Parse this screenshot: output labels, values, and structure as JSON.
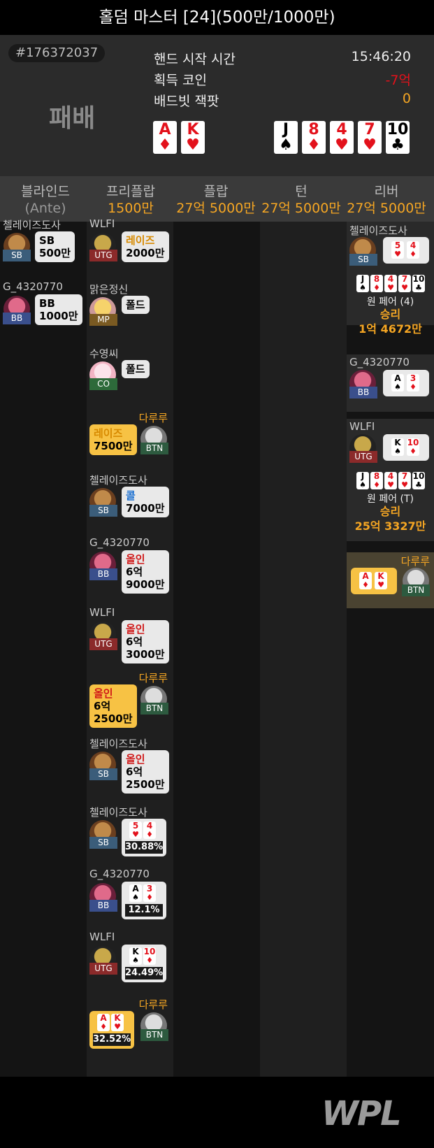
{
  "header": {
    "title": "홀덤 마스터 [24](500만/1000만)"
  },
  "info": {
    "hand_id": "#176372037",
    "result": "패배",
    "labels": {
      "start": "핸드 시작 시간",
      "coin": "획득 코인",
      "badbeat": "배드빗 잭팟"
    },
    "values": {
      "start": "15:46:20",
      "coin": "-7억",
      "badbeat": "0"
    },
    "hole": [
      {
        "rank": "A",
        "suit": "♦"
      },
      {
        "rank": "K",
        "suit": "♥"
      }
    ],
    "board": [
      {
        "rank": "J",
        "suit": "♠"
      },
      {
        "rank": "8",
        "suit": "♦"
      },
      {
        "rank": "4",
        "suit": "♥"
      },
      {
        "rank": "7",
        "suit": "♥"
      },
      {
        "rank": "10",
        "suit": "♣"
      }
    ]
  },
  "columns": [
    {
      "name": "블라인드",
      "value": "(Ante)"
    },
    {
      "name": "프리플랍",
      "value": "1500만"
    },
    {
      "name": "플랍",
      "value": "27억 5000만"
    },
    {
      "name": "턴",
      "value": "27억 5000만"
    },
    {
      "name": "리버",
      "value": "27억 5000만"
    }
  ],
  "blinds": [
    {
      "name": "첼레이즈도사",
      "pos": "SB",
      "action": "SB",
      "amount": "500만"
    },
    {
      "name": "G_4320770",
      "pos": "BB",
      "action": "BB",
      "amount": "1000만"
    }
  ],
  "preflop": [
    {
      "name": "WLFI",
      "pos": "UTG",
      "action": "레이즈",
      "amount": "2000만"
    },
    {
      "name": "맑은정신",
      "pos": "MP",
      "action": "폴드",
      "amount": ""
    },
    {
      "name": "수영씨",
      "pos": "CO",
      "action": "폴드",
      "amount": ""
    },
    {
      "name": "다루루",
      "pos": "BTN",
      "action": "레이즈",
      "amount": "7500만"
    },
    {
      "name": "첼레이즈도사",
      "pos": "SB",
      "action": "콜",
      "amount": "7000만"
    },
    {
      "name": "G_4320770",
      "pos": "BB",
      "action": "올인",
      "amount1": "6억",
      "amount2": "9000만"
    },
    {
      "name": "WLFI",
      "pos": "UTG",
      "action": "올인",
      "amount1": "6억",
      "amount2": "3000만"
    },
    {
      "name": "다루루",
      "pos": "BTN",
      "action": "올인",
      "amount1": "6억",
      "amount2": "2500만"
    },
    {
      "name": "첼레이즈도사",
      "pos": "SB",
      "action": "올인",
      "amount1": "6억",
      "amount2": "2500만"
    }
  ],
  "equity": [
    {
      "name": "첼레이즈도사",
      "pos": "SB",
      "cards": [
        {
          "rank": "5",
          "suit": "♥"
        },
        {
          "rank": "4",
          "suit": "♦"
        }
      ],
      "pct": "30.88%"
    },
    {
      "name": "G_4320770",
      "pos": "BB",
      "cards": [
        {
          "rank": "A",
          "suit": "♠"
        },
        {
          "rank": "3",
          "suit": "♦"
        }
      ],
      "pct": "12.1%"
    },
    {
      "name": "WLFI",
      "pos": "UTG",
      "cards": [
        {
          "rank": "K",
          "suit": "♠"
        },
        {
          "rank": "10",
          "suit": "♦"
        }
      ],
      "pct": "24.49%"
    },
    {
      "name": "다루루",
      "pos": "BTN",
      "cards": [
        {
          "rank": "A",
          "suit": "♦"
        },
        {
          "rank": "K",
          "suit": "♥"
        }
      ],
      "pct": "32.52%"
    }
  ],
  "river": [
    {
      "name": "첼레이즈도사",
      "pos": "SB",
      "cards": [
        {
          "rank": "5",
          "suit": "♥"
        },
        {
          "rank": "4",
          "suit": "♦"
        }
      ],
      "hand": "원 페어 (4)",
      "win_label": "승리",
      "win_amount": "1억 4672만"
    },
    {
      "name": "G_4320770",
      "pos": "BB",
      "cards": [
        {
          "rank": "A",
          "suit": "♠"
        },
        {
          "rank": "3",
          "suit": "♦"
        }
      ]
    },
    {
      "name": "WLFI",
      "pos": "UTG",
      "cards": [
        {
          "rank": "K",
          "suit": "♠"
        },
        {
          "rank": "10",
          "suit": "♦"
        }
      ],
      "hand": "원 페어 (T)",
      "win_label": "승리",
      "win_amount": "25억 3327만"
    },
    {
      "name": "다루루",
      "pos": "BTN",
      "cards": [
        {
          "rank": "A",
          "suit": "♦"
        },
        {
          "rank": "K",
          "suit": "♥"
        }
      ]
    }
  ],
  "logo": "WPL",
  "colors": {
    "accent": "#f5a623",
    "loss": "#e3111b"
  }
}
